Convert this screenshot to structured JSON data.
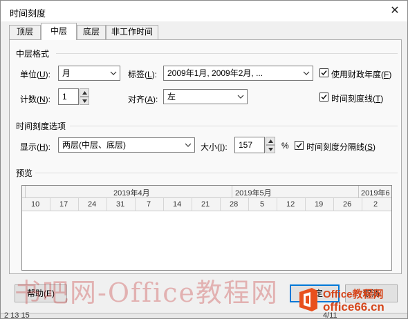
{
  "dialog": {
    "title": "时间刻度",
    "close_glyph": "✕"
  },
  "tabs": [
    {
      "label": "顶层"
    },
    {
      "label": "中层"
    },
    {
      "label": "底层"
    },
    {
      "label": "非工作时间"
    }
  ],
  "middle_format": {
    "section_title": "中层格式",
    "units_label_text": "单位(",
    "units_label_key": "U",
    "units_label_end": "):",
    "units_value": "月",
    "tag_label_text": "标签(",
    "tag_label_key": "L",
    "tag_label_end": "):",
    "tag_value": "2009年1月, 2009年2月, ...",
    "fiscal_label_text": "使用财政年度(",
    "fiscal_label_key": "F",
    "fiscal_label_end": ")",
    "fiscal_checked": true,
    "count_label_text": "计数(",
    "count_label_key": "N",
    "count_label_end": "):",
    "count_value": "1",
    "align_label_text": "对齐(",
    "align_label_key": "A",
    "align_label_end": "):",
    "align_value": "左",
    "tickline_label_text": "时间刻度线(",
    "tickline_label_key": "T",
    "tickline_label_end": ")",
    "tickline_checked": true
  },
  "timescale_options": {
    "section_title": "时间刻度选项",
    "show_label_text": "显示(",
    "show_label_key": "H",
    "show_label_end": "):",
    "show_value": "两层(中层、底层)",
    "size_label_text": "大小(",
    "size_label_key": "I",
    "size_label_end": "):",
    "size_value": "157",
    "percent": "%",
    "separator_label_text": "时间刻度分隔线(",
    "separator_label_key": "S",
    "separator_label_end": ")",
    "separator_checked": true
  },
  "preview": {
    "section_title": "预览",
    "months": [
      "2019年4月",
      "2019年5月",
      "2019年6"
    ],
    "days": [
      "10",
      "17",
      "24",
      "31",
      "7",
      "14",
      "21",
      "28",
      "5",
      "12",
      "19",
      "26",
      "2"
    ]
  },
  "buttons": {
    "help": "帮助(E)",
    "ok": "确定",
    "cancel": "取消"
  },
  "watermark": {
    "text": "书吧网-Office教程网",
    "logo_line1": "Office教程网",
    "logo_line2": "office66.cn"
  },
  "background": {
    "left_text": "2 13 15",
    "right_text": "4/11"
  },
  "colors": {
    "accent": "#0078d7",
    "logo": "#d6461b"
  }
}
